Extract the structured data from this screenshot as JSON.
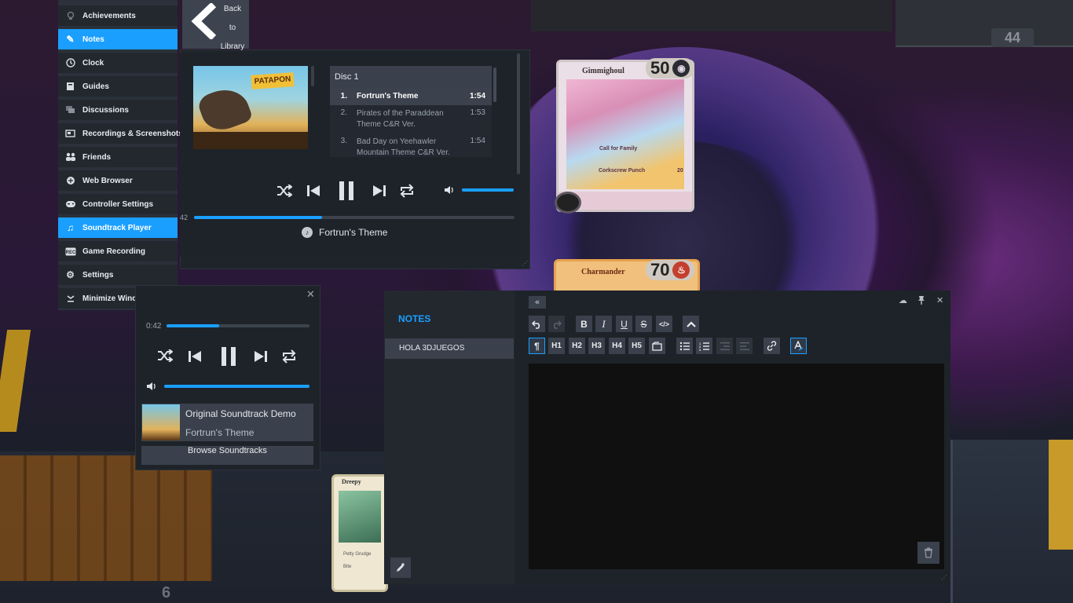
{
  "background": {
    "badge_number": "44",
    "bottom_number": "6",
    "card_gimmighoul": {
      "name": "Gimmighoul",
      "hp": "50",
      "attack1": "Call for Family",
      "attack2": "Corkscrew Punch",
      "damage": "20"
    },
    "card_charmander": {
      "name": "Charmander",
      "hp": "70"
    },
    "card_dreepy": {
      "name": "Dreepy",
      "text1": "Petty Grudge",
      "text2": "Bite"
    }
  },
  "sidebar": {
    "items": [
      {
        "label": "Achievements",
        "icon": "trophy-icon"
      },
      {
        "label": "Notes",
        "icon": "pencil-icon",
        "active": true
      },
      {
        "label": "Clock",
        "icon": "clock-icon"
      },
      {
        "label": "Guides",
        "icon": "book-icon"
      },
      {
        "label": "Discussions",
        "icon": "chat-icon"
      },
      {
        "label": "Recordings & Screenshots",
        "icon": "screenshot-icon"
      },
      {
        "label": "Friends",
        "icon": "friends-icon"
      },
      {
        "label": "Web Browser",
        "icon": "globe-icon"
      },
      {
        "label": "Controller Settings",
        "icon": "gamepad-icon"
      },
      {
        "label": "Soundtrack Player",
        "icon": "music-note-icon",
        "active": true
      },
      {
        "label": "Game Recording",
        "icon": "rec-icon"
      },
      {
        "label": "Settings",
        "icon": "gear-icon"
      },
      {
        "label": "Minimize Wind",
        "icon": "minimize-icon"
      }
    ]
  },
  "soundtrack_player": {
    "back_label_1": "Back",
    "back_label_2": "to",
    "back_label_3": "Library",
    "album_logo": "PATAPON",
    "disc_label": "Disc 1",
    "tracks": [
      {
        "num": "1.",
        "name": "Fortrun's Theme",
        "duration": "1:54",
        "current": true
      },
      {
        "num": "2.",
        "name": "Pirates of the Paraddean Theme C&R Ver.",
        "duration": "1:53"
      },
      {
        "num": "3.",
        "name": "Bad Day on Yeehawler Mountain Theme C&R Ver.",
        "duration": "1:54"
      }
    ],
    "elapsed": "42",
    "progress": 0.4,
    "volume": 1.0,
    "now_playing": "Fortrun's Theme",
    "accent": "#1a9fff"
  },
  "mini_player": {
    "elapsed": "0:42",
    "progress": 0.37,
    "volume": 1.0,
    "album_title": "Original Soundtrack Demo",
    "track_title": "Fortrun's Theme",
    "browse_label": "Browse Soundtracks"
  },
  "notes": {
    "title": "NOTES",
    "items": [
      {
        "label": "HOLA 3DJUEGOS"
      }
    ],
    "toolbar": {
      "row1": [
        "undo",
        "redo",
        "B",
        "I",
        "U",
        "S",
        "</>",
        "^"
      ],
      "row2": [
        "¶",
        "H1",
        "H2",
        "H3",
        "H4",
        "H5",
        "quote",
        "bullets",
        "numbers",
        "outdent",
        "indent",
        "link",
        "clear-format"
      ]
    },
    "editor_content": ""
  }
}
